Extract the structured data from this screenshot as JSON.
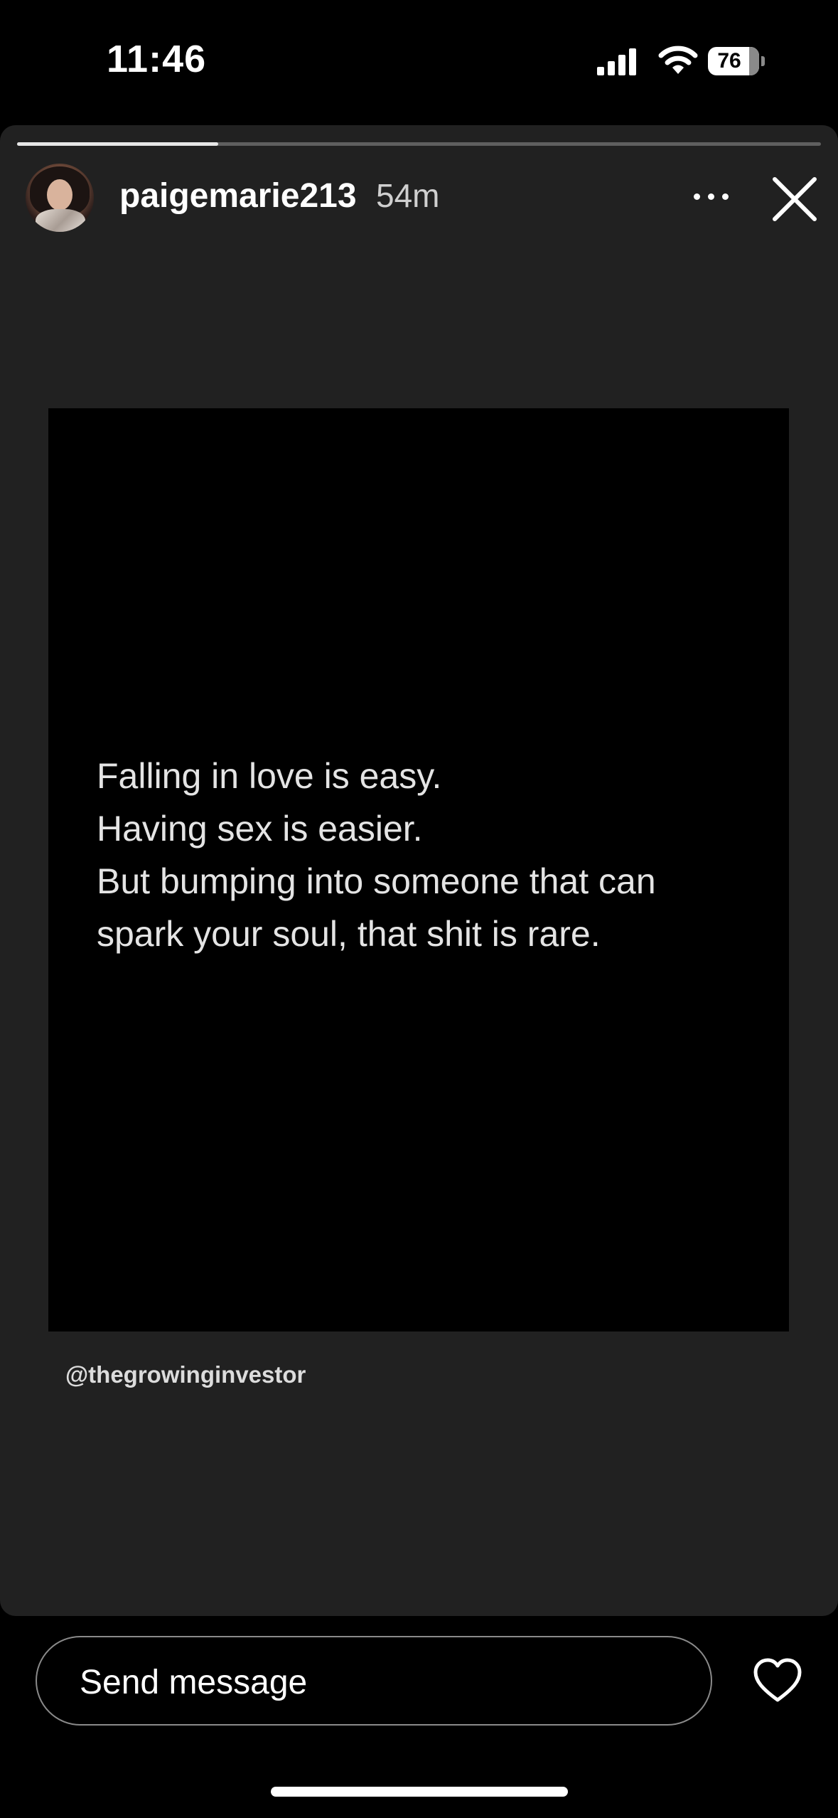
{
  "status_bar": {
    "time": "11:46",
    "battery": "76",
    "battery_level_percent": 76
  },
  "story": {
    "progress_percent": 25,
    "username": "paigemarie213",
    "timestamp": "54m",
    "quote_lines": [
      "Falling in love is easy.",
      "Having sex is easier.",
      "But bumping into someone that can",
      "spark your soul, that shit is rare."
    ],
    "credit": "@thegrowinginvestor"
  },
  "footer": {
    "message_placeholder": "Send message"
  },
  "colors": {
    "background": "#000000",
    "card": "#212121",
    "text": "#ffffff",
    "muted_text": "#cfcfcf"
  },
  "icons": {
    "signal": "signal-icon",
    "wifi": "wifi-icon",
    "battery": "battery-icon",
    "more": "more-icon",
    "close": "close-icon",
    "heart": "heart-icon"
  }
}
